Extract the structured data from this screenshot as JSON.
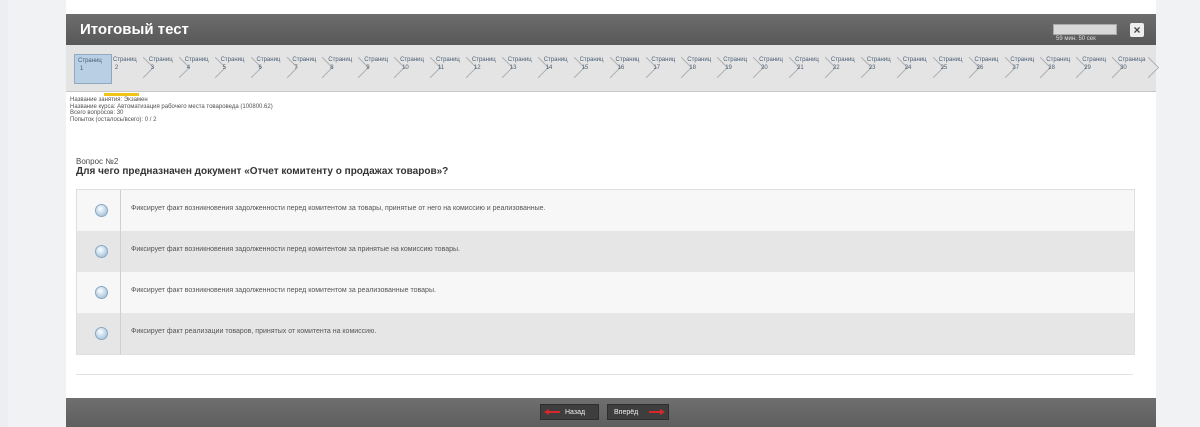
{
  "window": {
    "title": "Итоговый тест",
    "timer": "59 мин. 50 сек",
    "close_label": "×"
  },
  "tabs": [
    {
      "label": "Страниц",
      "num": "1",
      "active": true
    },
    {
      "label": "Страниц",
      "num": "2"
    },
    {
      "label": "Страниц",
      "num": "3"
    },
    {
      "label": "Страниц",
      "num": "4"
    },
    {
      "label": "Страниц",
      "num": "5"
    },
    {
      "label": "Страниц",
      "num": "6"
    },
    {
      "label": "Страниц",
      "num": "7"
    },
    {
      "label": "Страниц",
      "num": "8"
    },
    {
      "label": "Страниц",
      "num": "9"
    },
    {
      "label": "Страниц",
      "num": "10"
    },
    {
      "label": "Страниц",
      "num": "11"
    },
    {
      "label": "Страниц",
      "num": "12"
    },
    {
      "label": "Страниц",
      "num": "13"
    },
    {
      "label": "Страниц",
      "num": "14"
    },
    {
      "label": "Страниц",
      "num": "15"
    },
    {
      "label": "Страниц",
      "num": "16"
    },
    {
      "label": "Страниц",
      "num": "17"
    },
    {
      "label": "Страниц",
      "num": "18"
    },
    {
      "label": "Страниц",
      "num": "19"
    },
    {
      "label": "Страниц",
      "num": "20"
    },
    {
      "label": "Страниц",
      "num": "21"
    },
    {
      "label": "Страниц",
      "num": "22"
    },
    {
      "label": "Страниц",
      "num": "23"
    },
    {
      "label": "Страниц",
      "num": "24"
    },
    {
      "label": "Страниц",
      "num": "25"
    },
    {
      "label": "Страниц",
      "num": "26"
    },
    {
      "label": "Страниц",
      "num": "27"
    },
    {
      "label": "Страниц",
      "num": "28"
    },
    {
      "label": "Страниц",
      "num": "29"
    },
    {
      "label": "Страница",
      "num": "30"
    }
  ],
  "info": {
    "lesson": "Название занятия: Экзамен",
    "course": "Название курса: Автоматизация рабочего места товароведа (100800.62)",
    "total": "Всего вопросов: 30",
    "attempts": "Попыток (осталось/всего): 0 / 2"
  },
  "question": {
    "number": "Вопрос №2",
    "text": "Для чего предназначен документ «Отчет комитенту о продажах товаров»?"
  },
  "answers": [
    "Фиксирует факт возникновения задолженности перед комитентом за товары, принятые от него на комиссию и реализованные.",
    "Фиксирует факт возникновения задолженности перед комитентом за принятые на комиссию товары.",
    "Фиксирует факт возникновения задолженности перед комитентом за реализованные товары.",
    "Фиксирует факт реализации товаров, принятых от комитента на комиссию."
  ],
  "nav": {
    "back": "Назад",
    "forward": "Вперёд"
  },
  "colors": {
    "arrow": "#d9262b",
    "active_tab": "#b9cfe4",
    "tab_indicator": "#f0c419"
  }
}
